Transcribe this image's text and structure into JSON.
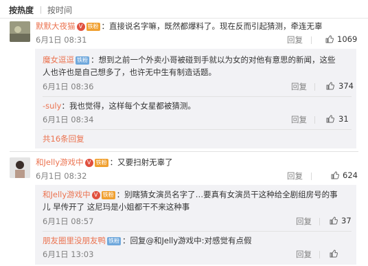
{
  "sort": {
    "hot": "按热度",
    "time": "按时间"
  },
  "comments": [
    {
      "user": "默默大夜猫",
      "badge": "铁粉",
      "text": "直接说名字嘛，既然都爆料了。现在反而引起猜测，牵连无辜",
      "time": "6月1日 08:31",
      "reply": "回复",
      "likes": "1069",
      "replies": [
        {
          "user": "魔女逗逗",
          "badge": "铁粉",
          "text_line1": "想到之前一个外卖小哥被碰到手就以为女的对他有意思的新闻，这些",
          "text_line2": "人也许也是自己想多了，也许无中生有制造话题。",
          "time": "6月1日 08:36",
          "reply": "回复",
          "likes": "374"
        },
        {
          "user": "-suly",
          "text": "我也觉得，这样每个女星都被猜测。",
          "time": "6月1日 08:34",
          "reply": "回复",
          "likes": "31"
        }
      ],
      "more": "共16条回复"
    },
    {
      "user": "和Jelly游戏中",
      "badge": "铁粉",
      "text": "又要扫射无辜了",
      "time": "6月1日 08:32",
      "reply": "回复",
      "likes": "624",
      "replies": [
        {
          "user": "和Jelly游戏中",
          "badge": "铁粉",
          "text_line1": "别瞎猜女演员名字了…要真有女演员干这种给全剧组房号的事",
          "text_line2": "儿 早传开了 这尼玛是小姐都干不来这种事",
          "time": "6月1日 08:57",
          "reply": "回复",
          "likes": "37"
        },
        {
          "user": "朋友圈里没朋友鸭",
          "badge": "铁粉",
          "text": "回复@和Jelly游戏中:对感觉有点假",
          "time": "6月1日 13:03",
          "reply": "回复",
          "likes": ""
        }
      ]
    }
  ],
  "colors": {
    "accent": "#eb7350",
    "timestamp": "#808080",
    "reply_bg": "#f2f2f5"
  },
  "icons": {
    "like": "thumbs-up-icon",
    "vip": "vip-crown-icon"
  }
}
